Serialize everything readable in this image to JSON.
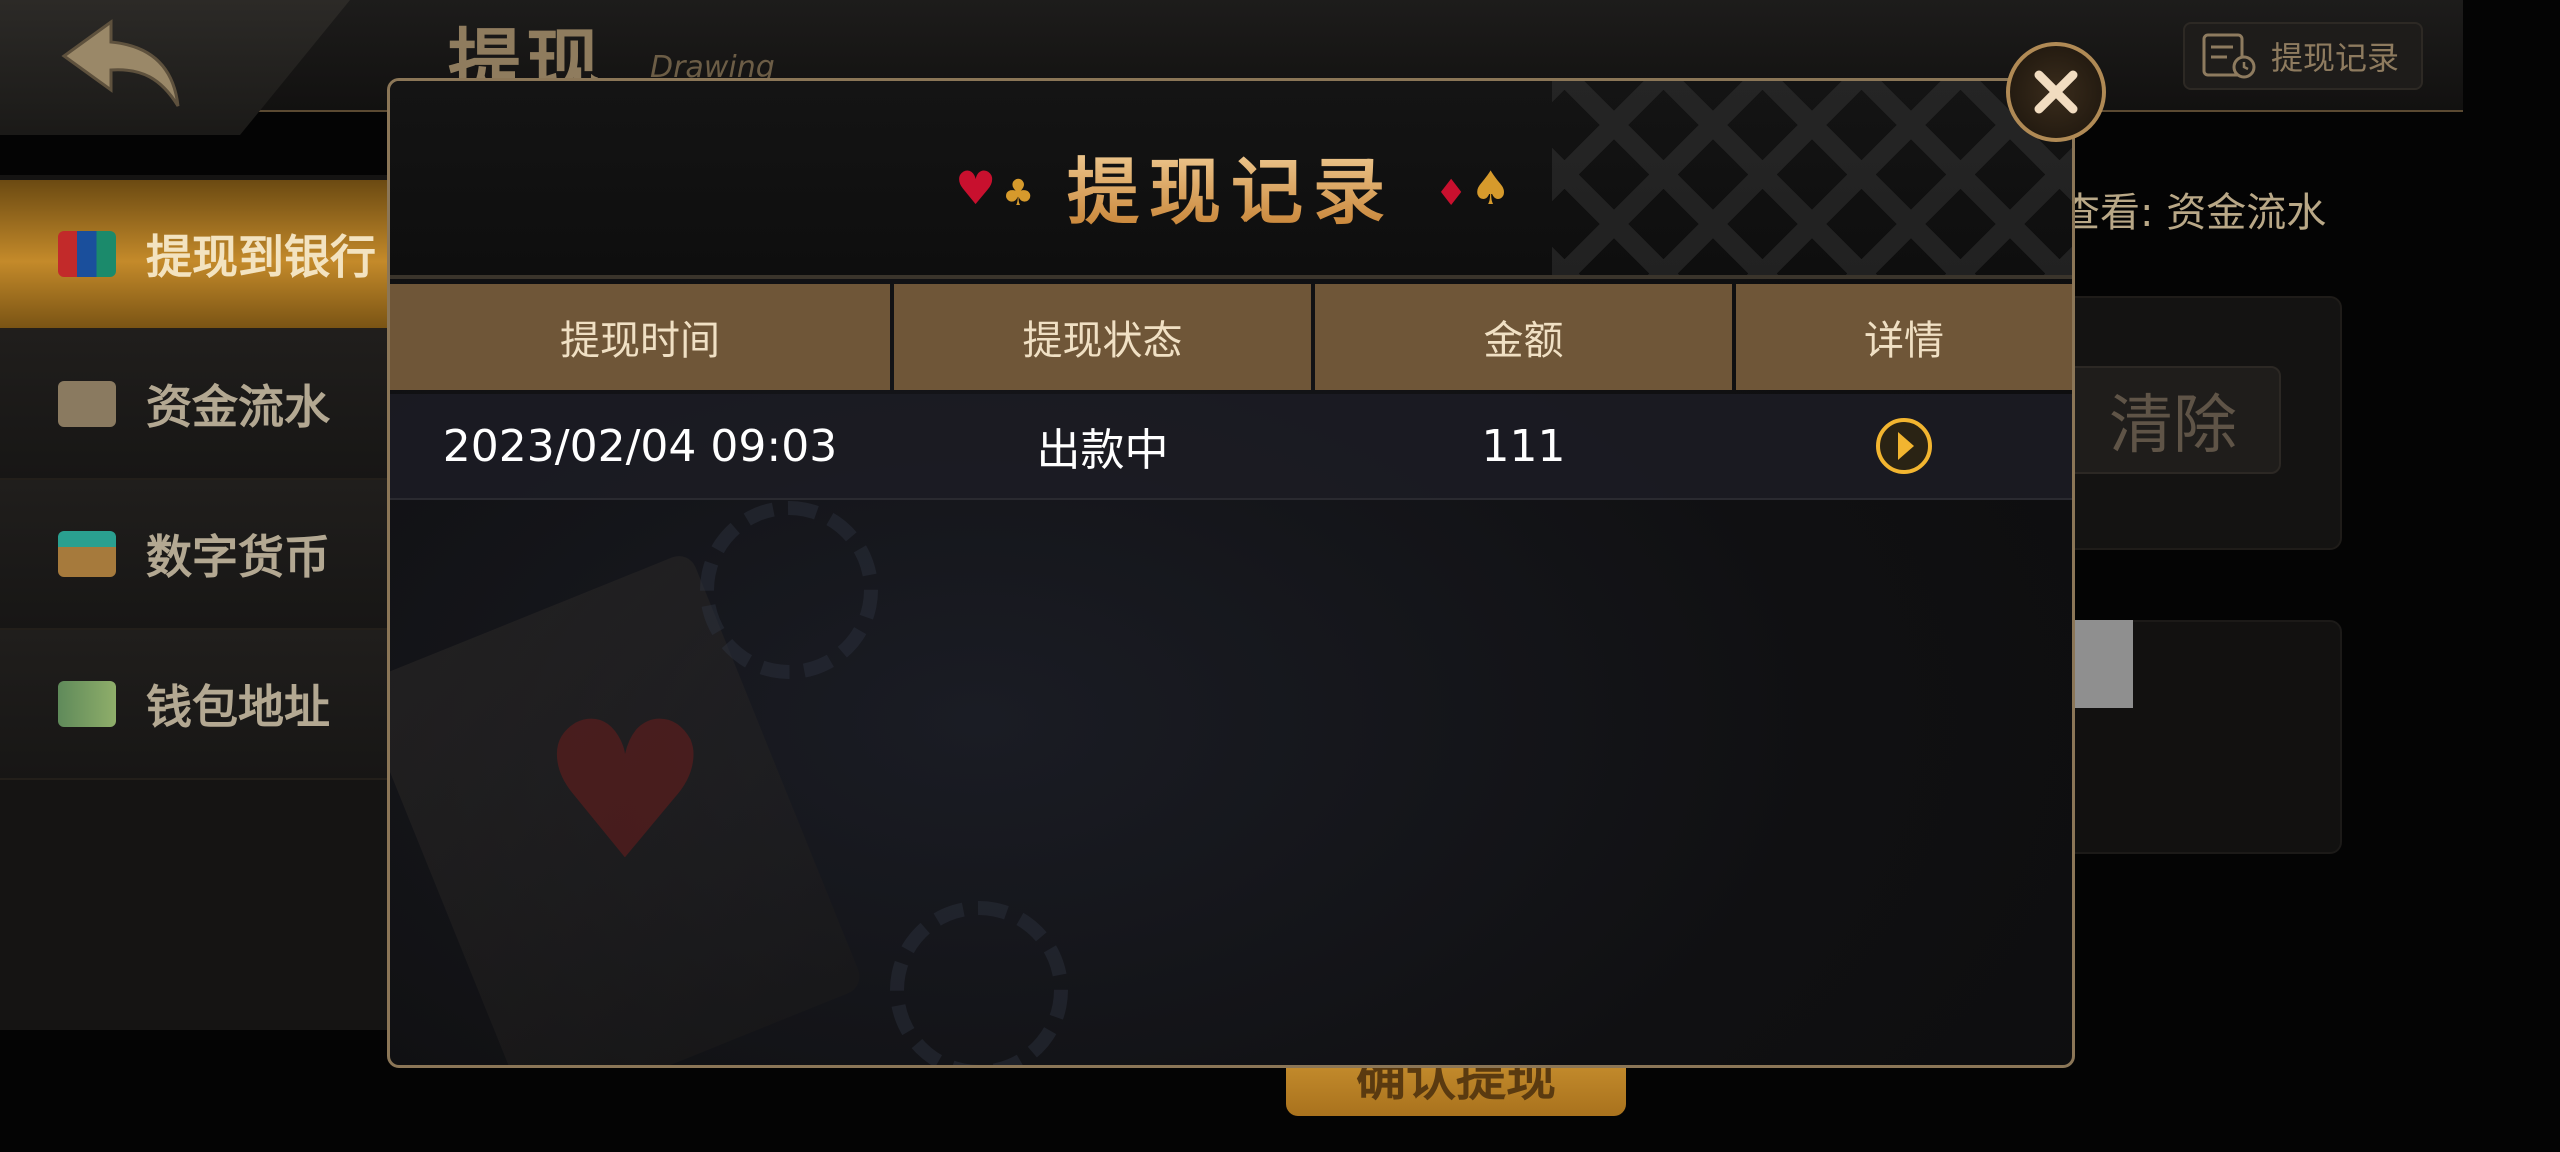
{
  "header": {
    "title": "提现",
    "subtitle": "Drawing",
    "records_button_label": "提现记录"
  },
  "sidebar": {
    "items": [
      {
        "label": "提现到银行",
        "icon": "unionpay-card-icon",
        "active": true
      },
      {
        "label": "资金流水",
        "icon": "funds-ledger-icon",
        "active": false
      },
      {
        "label": "数字货币",
        "icon": "wallet-yen-icon",
        "active": false
      },
      {
        "label": "钱包地址",
        "icon": "map-pin-icon",
        "active": false
      }
    ]
  },
  "right": {
    "hint": "查看: 资金流水",
    "clear_label": "清除",
    "confirm_label": "确认提现"
  },
  "modal": {
    "title": "提现记录",
    "columns": [
      "提现时间",
      "提现状态",
      "金额",
      "详情"
    ],
    "rows": [
      {
        "time": "2023/02/04 09:03",
        "status": "出款中",
        "amount": "111",
        "detail_icon": "chevron-right-circle-icon"
      }
    ]
  },
  "colors": {
    "accent_gold": "#c48a2a",
    "table_header": "#6f5638",
    "modal_border": "#8b7657"
  }
}
